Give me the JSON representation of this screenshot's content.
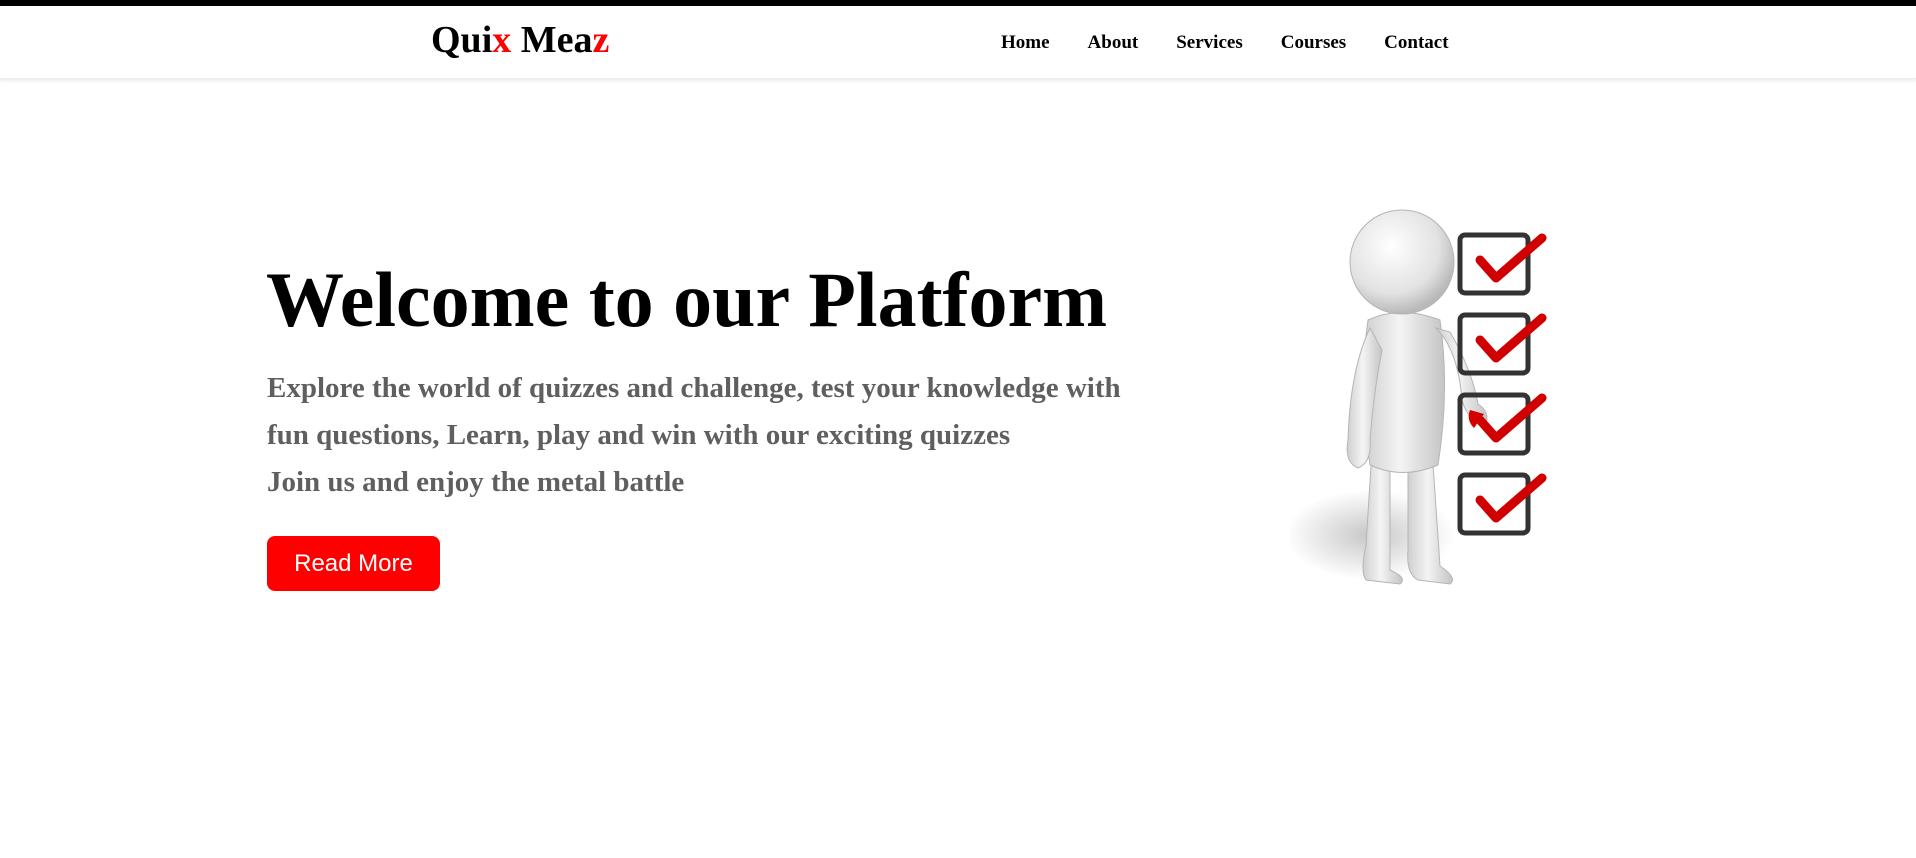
{
  "brand": {
    "part1": "Qui",
    "part2": "x",
    "part3": " Mea",
    "part4": "z",
    "accent_color": "#ff0000"
  },
  "nav": {
    "items": [
      {
        "label": "Home"
      },
      {
        "label": "About"
      },
      {
        "label": "Services"
      },
      {
        "label": "Courses"
      },
      {
        "label": "Contact"
      }
    ]
  },
  "hero": {
    "title": "Welcome to our Platform",
    "lines": [
      "Explore the world of quizzes and challenge, test your knowledge with",
      "fun questions, Learn, play and win with our exciting quizzes",
      "Join us and enjoy the metal battle"
    ],
    "button_label": "Read More",
    "button_color": "#ff0000",
    "text_color": "#5f5f5f"
  },
  "illustration": {
    "icon": "stick-figure-checklist-icon",
    "checkbox_count": 4
  }
}
